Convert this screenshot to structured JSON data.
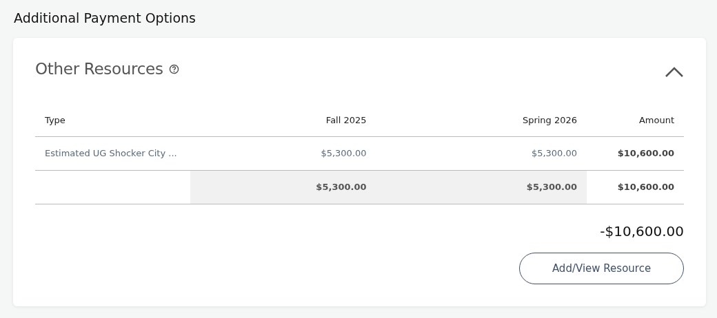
{
  "page_title": "Additional Payment Options",
  "section": {
    "title": "Other Resources",
    "expanded": true,
    "columns": [
      "Type",
      "Fall 2025",
      "Spring 2026",
      "Amount"
    ],
    "rows": [
      {
        "cells": [
          "Estimated UG Shocker City ...",
          "$5,300.00",
          "$5,300.00",
          "$10,600.00"
        ]
      }
    ],
    "totals": [
      "$5,300.00",
      "$5,300.00",
      "$10,600.00"
    ],
    "net_total": "-$10,600.00",
    "button": "Add/View Resource"
  }
}
